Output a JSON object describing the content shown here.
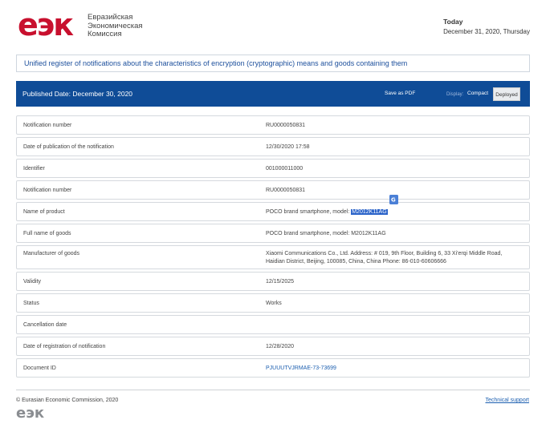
{
  "header": {
    "logo_mark": "еэк",
    "logo_lines": [
      "Евразийская",
      "Экономическая",
      "Комиссия"
    ],
    "today_label": "Today",
    "today_date": "December 31, 2020, Thursday"
  },
  "register_title": "Unified register of notifications about the characteristics of encryption (cryptographic) means and goods containing them",
  "bar": {
    "published": "Published Date: December 30, 2020",
    "save_pdf": "Save as PDF",
    "display_label": "Display:",
    "compact": "Compact",
    "deployed": "Deployed"
  },
  "rows": [
    {
      "label": "Notification number",
      "value": "RU0000050831"
    },
    {
      "label": "Date of publication of the notification",
      "value": "12/30/2020 17:58"
    },
    {
      "label": "Identifier",
      "value": "001000011000"
    },
    {
      "label": "Notification number",
      "value": "RU0000050831"
    },
    {
      "label": "Name of product",
      "value_prefix": "POCO brand smartphone, model: ",
      "value_highlight": "M2012K11AG"
    },
    {
      "label": "Full name of goods",
      "value": "POCO brand smartphone, model: M2012K11AG"
    },
    {
      "label": "Manufacturer of goods",
      "value_line1": "Xiaomi Communications Co., Ltd. Address: # 019, 9th Floor, Building 6, 33 Xi'erqi Middle Road,",
      "value_line2": "Haidian District, Beijing, 100085, China, China Phone: 86-010-60606666"
    },
    {
      "label": "Validity",
      "value": "12/15/2025"
    },
    {
      "label": "Status",
      "value": "Works"
    },
    {
      "label": "Cancellation date",
      "value": ""
    },
    {
      "label": "Date of registration of notification",
      "value": "12/28/2020"
    },
    {
      "label": "Document ID",
      "value": "PJUUUTVJRMAE-73-73699"
    }
  ],
  "footer": {
    "copyright": "© Eurasian Economic Commission, 2020",
    "tech_support": "Technical support",
    "logo_mark": "еэк"
  },
  "colors": {
    "brand_red": "#c8102e",
    "bar_blue": "#0f4c97",
    "link_blue": "#1c5fb0",
    "highlight": "#2a63c9"
  },
  "icons": {
    "translate": "translate-icon"
  }
}
